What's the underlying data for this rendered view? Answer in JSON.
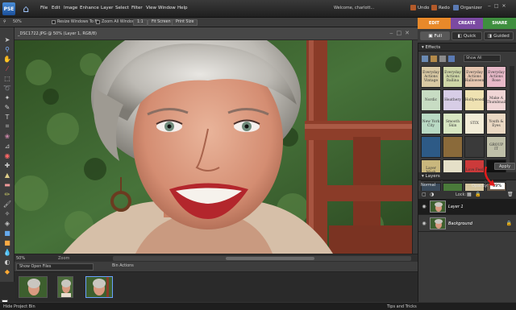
{
  "menubar": {
    "logo": "PSE",
    "items": [
      "File",
      "Edit",
      "Image",
      "Enhance",
      "Layer",
      "Select",
      "Filter",
      "View",
      "Window",
      "Help"
    ],
    "welcome": "Welcome, charlott...",
    "undo": "Undo",
    "redo": "Redo",
    "organizer": "Organizer"
  },
  "options": {
    "zoom_value": "50%",
    "resize_windows": "Resize Windows To Fit",
    "zoom_all": "Zoom All Windows",
    "one_to_one": "1:1",
    "fit_screen": "Fit Screen",
    "print_size": "Print Size"
  },
  "modes": {
    "edit": "EDIT",
    "create": "CREATE",
    "share": "SHARE",
    "full": "Full",
    "quick": "Quick",
    "guided": "Guided"
  },
  "document": {
    "title": "_DSC1722.JPG @ 50% (Layer 1, RGB/8)",
    "zoom": "50%",
    "zoom_label": "Zoom"
  },
  "bin": {
    "select": "Show Open Files",
    "actions": "Bin Actions",
    "hide": "Hide Project Bin",
    "tips": "Tips and Tricks"
  },
  "effects": {
    "title": "Effects",
    "filter": "Show All",
    "apply": "Apply",
    "tiles": [
      {
        "label": "Everyday Actions Vintage",
        "bg": "#d9c9a4"
      },
      {
        "label": "Everyday Actions Ballina",
        "bg": "#cfd7a8"
      },
      {
        "label": "Everyday Actions Halloween",
        "bg": "#e6c6b0"
      },
      {
        "label": "Everyday Actions Rose",
        "bg": "#e7b9c8"
      },
      {
        "label": "Nordic",
        "bg": "#c7dcc3"
      },
      {
        "label": "Heathery",
        "bg": "#d7cde6"
      },
      {
        "label": "Hollywood",
        "bg": "#efe2b2"
      },
      {
        "label": "Make A Thumbnail",
        "bg": "#f0d5d5"
      },
      {
        "label": "New York City",
        "bg": "#b9d9c4"
      },
      {
        "label": "Smooth Skin",
        "bg": "#d8e6c2"
      },
      {
        "label": "STIX",
        "bg": "#f2ecd7"
      },
      {
        "label": "Youth & Eyes",
        "bg": "#ead8c3"
      },
      {
        "label": "",
        "bg": "#2d5a86"
      },
      {
        "label": "",
        "bg": "#8a6a3a"
      },
      {
        "label": "",
        "bg": "#3a3a3a"
      },
      {
        "label": "GROUP IT",
        "bg": "#bfbfa8"
      },
      {
        "label": "Layer Mask",
        "bg": "#c9b77d"
      },
      {
        "label": "",
        "bg": "#e5e0c8"
      },
      {
        "label": "Love Feel",
        "bg": "#cc3a3a"
      },
      {
        "label": "",
        "bg": "#111111"
      },
      {
        "label": "",
        "bg": "#3a4a5a"
      },
      {
        "label": "",
        "bg": "#4a7a3a"
      },
      {
        "label": "",
        "bg": "#d6c7a0"
      },
      {
        "label": "",
        "bg": "#6a5a4a"
      }
    ]
  },
  "layers": {
    "title": "Layers",
    "blend_mode": "Normal",
    "opacity_label": "Opacity:",
    "opacity_value": "39%",
    "lock_label": "Lock:",
    "items": [
      {
        "name": "Layer 1"
      },
      {
        "name": "Background"
      }
    ]
  }
}
